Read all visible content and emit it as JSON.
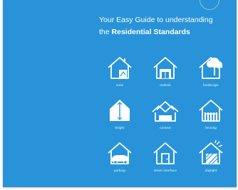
{
  "cover": {
    "background": "#2893d8",
    "title_line1": "Your Easy Guide to understanding",
    "title_line2_prefix": "the",
    "title_line2_bold": "Residential Standards"
  },
  "topics": [
    {
      "label": "zone",
      "icon": "house-with-zone-map-icon"
    },
    {
      "label": "outlook",
      "icon": "house-with-window-icon"
    },
    {
      "label": "landscape",
      "icon": "house-with-tree-icon"
    },
    {
      "label": "height",
      "icon": "house-height-icon"
    },
    {
      "label": "context",
      "icon": "house-neighbour-roofs-icon"
    },
    {
      "label": "fencing",
      "icon": "house-with-fence-icon"
    },
    {
      "label": "parking",
      "icon": "house-with-car-icon"
    },
    {
      "label": "street interface",
      "icon": "house-with-door-icon"
    },
    {
      "label": "daylight",
      "icon": "house-with-sun-rays-icon"
    }
  ]
}
